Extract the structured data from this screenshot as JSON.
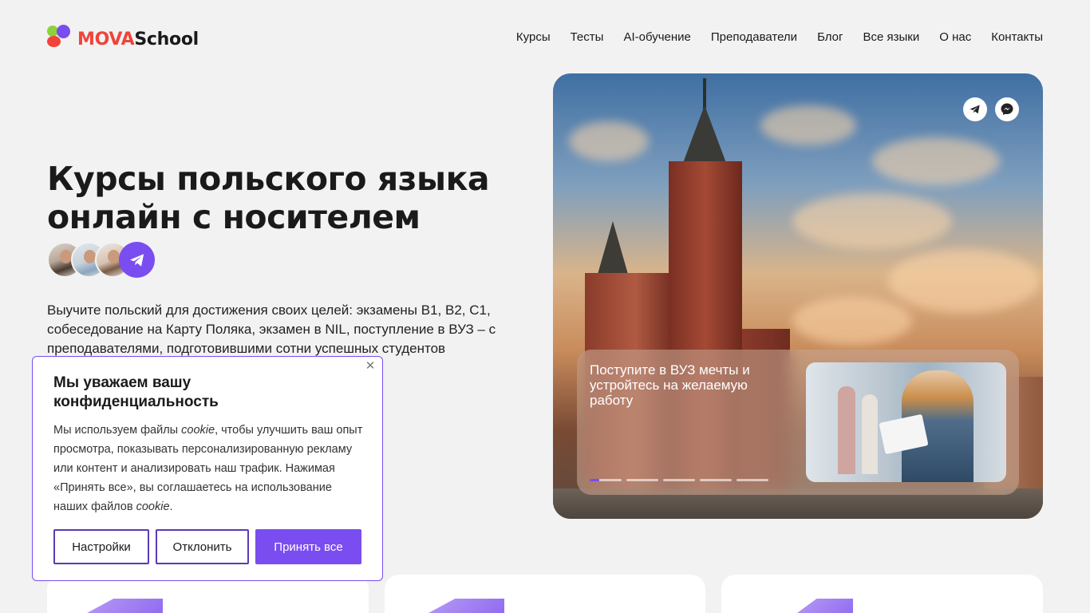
{
  "logo": {
    "part1": "MOVA",
    "part2": "School"
  },
  "nav": [
    "Курсы",
    "Тесты",
    "AI-обучение",
    "Преподаватели",
    "Блог",
    "Все языки",
    "О нас",
    "Контакты"
  ],
  "hero": {
    "title": "Курсы польского языка онлайн с носителем",
    "description": "Выучите польский для достижения своих целей: экзамены B1, B2, C1, собеседование на Карту Поляка, экзамен в NIL, поступление в ВУЗ – с преподавателями, подготовившими сотни успешных студентов"
  },
  "promo": {
    "text": "Поступите в ВУЗ мечты и устройтесь на желаемую работу",
    "slides_total": 5,
    "active_slide": 1
  },
  "cookie": {
    "title": "Мы уважаем вашу конфиденциальность",
    "body_1": "Мы используем файлы ",
    "body_cookie_1": "cookie",
    "body_2": ", чтобы улучшить ваш опыт просмотра, показывать персонализированную рекламу или контент и анализировать наш трафик. Нажимая «Принять все», вы соглашаетесь на использование наших файлов ",
    "body_cookie_2": "cookie",
    "body_3": ".",
    "settings_label": "Настройки",
    "decline_label": "Отклонить",
    "accept_label": "Принять все",
    "close_icon": "close-icon"
  },
  "colors": {
    "accent": "#7a4df0",
    "logo_red": "#f0443a",
    "logo_green": "#8bd33a",
    "background": "#f2f2f2"
  },
  "icons": {
    "telegram": "telegram-icon",
    "messenger": "messenger-icon"
  }
}
